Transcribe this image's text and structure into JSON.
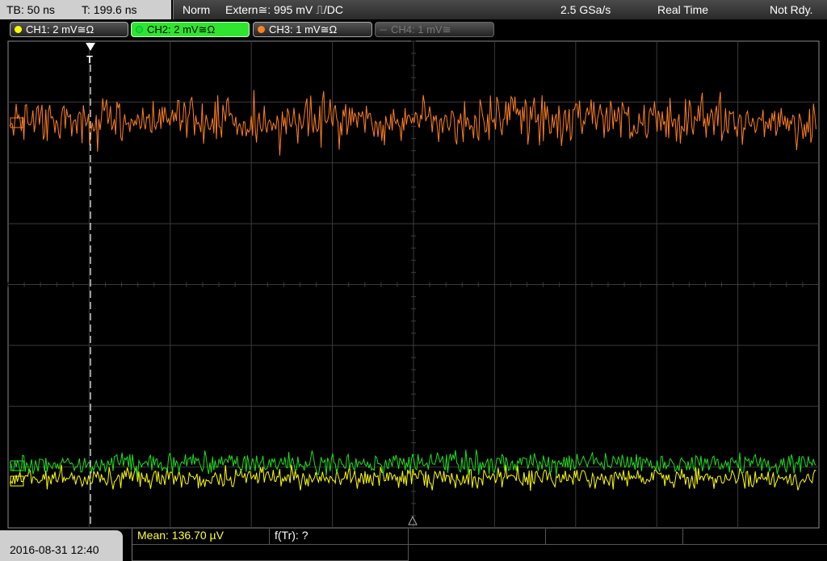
{
  "header": {
    "timebase": "TB: 50 ns",
    "trigger_pos": "T: 199.6 ns",
    "mode": "Norm",
    "trigger_source": "Extern≅: 995 mV ⎍/DC",
    "sample_rate": "2.5 GSa/s",
    "acq_mode": "Real Time",
    "status": "Not Rdy."
  },
  "channels": [
    {
      "label": "CH1: 2 mV≅Ω",
      "color": "#ffff00",
      "active": false,
      "enabled": true
    },
    {
      "label": "CH2: 2 mV≅Ω",
      "color": "#1fe01f",
      "active": true,
      "enabled": true
    },
    {
      "label": "CH3: 1 mV≅Ω",
      "color": "#ff8020",
      "active": false,
      "enabled": true
    },
    {
      "label": "CH4: 1 mV≅",
      "color": "#666666",
      "active": false,
      "enabled": false
    }
  ],
  "footer": {
    "datetime": "2016-08-31 12:40",
    "mean": "Mean: 136.70 µV",
    "ftr": "f(Tr): ?"
  },
  "colors": {
    "ch1": "#ffff00",
    "ch2": "#1fe01f",
    "ch3": "#ff8020",
    "grid": "#3a3a3a",
    "mean_text": "#ffff40"
  },
  "trigger_marker": "T"
}
